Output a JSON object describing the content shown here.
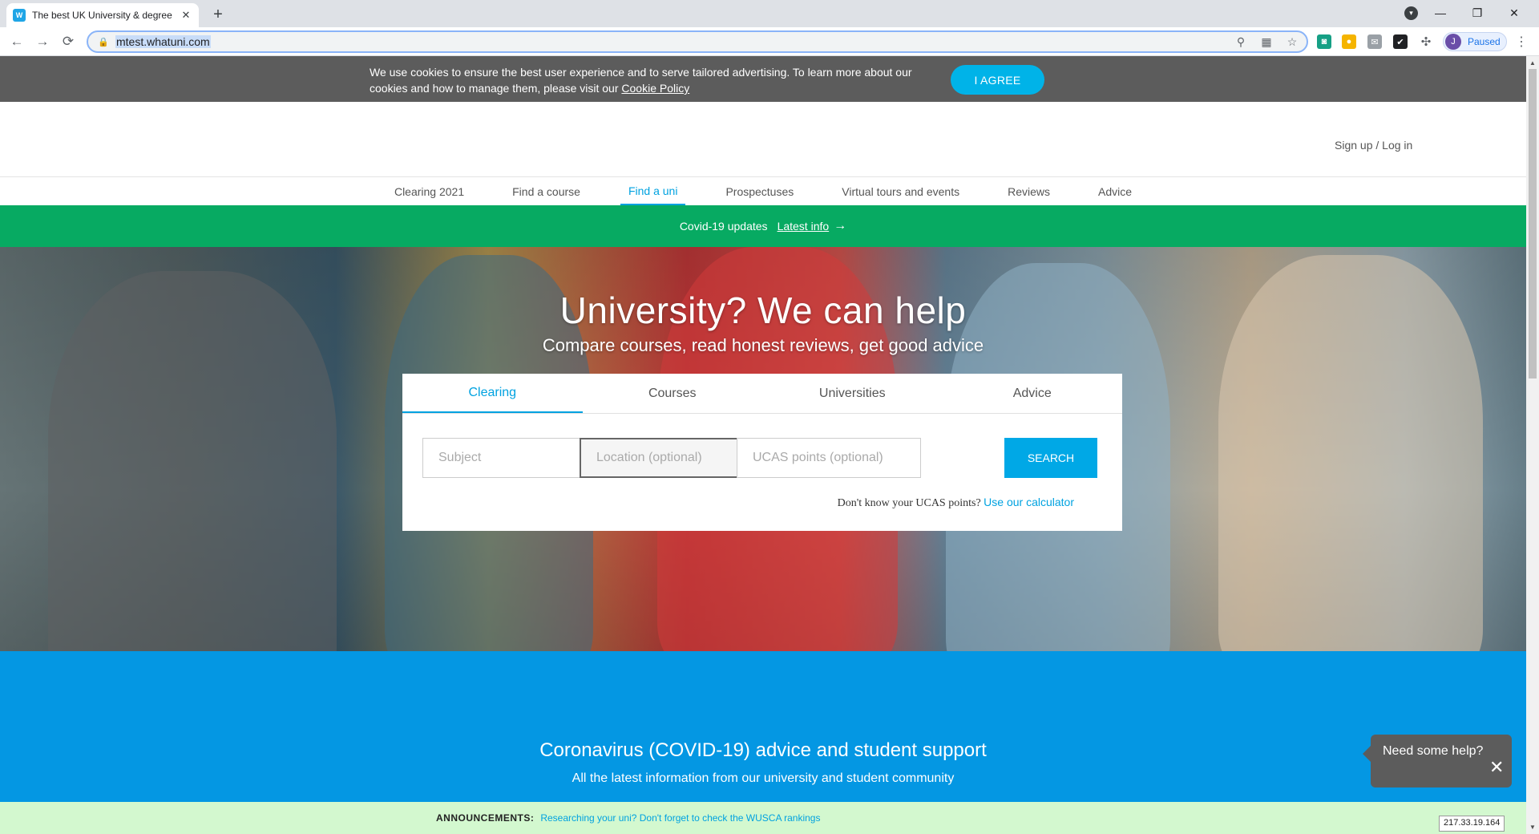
{
  "browser": {
    "tab_title": "The best UK University & degree",
    "favicon_text": "W",
    "url": "mtest.whatuni.com",
    "profile_initial": "J",
    "profile_status": "Paused"
  },
  "cookie": {
    "text": "We use cookies to ensure the best user experience and to serve tailored advertising. To learn more about our cookies and how to manage them, please visit our",
    "policy_link": "Cookie Policy",
    "agree_button": "I AGREE"
  },
  "header": {
    "signup_login": "Sign up / Log in"
  },
  "nav": {
    "items": [
      {
        "label": "Clearing 2021"
      },
      {
        "label": "Find a course"
      },
      {
        "label": "Find a uni"
      },
      {
        "label": "Prospectuses"
      },
      {
        "label": "Virtual tours and events"
      },
      {
        "label": "Reviews"
      },
      {
        "label": "Advice"
      }
    ],
    "active": "Find a uni"
  },
  "covid_bar": {
    "text": "Covid-19 updates",
    "link": "Latest info",
    "arrow": "→"
  },
  "hero": {
    "title": "University? We can help",
    "subtitle": "Compare courses, read honest reviews, get good advice"
  },
  "search": {
    "tabs": [
      {
        "label": "Clearing"
      },
      {
        "label": "Courses"
      },
      {
        "label": "Universities"
      },
      {
        "label": "Advice"
      }
    ],
    "active_tab": "Clearing",
    "subject_placeholder": "Subject",
    "location_placeholder": "Location (optional)",
    "ucas_placeholder": "UCAS points (optional)",
    "button": "SEARCH",
    "help_text": "Don't know your UCAS points?",
    "help_link": "Use our calculator"
  },
  "advice": {
    "title": "Coronavirus (COVID-19) advice and student support",
    "subtitle": "All the latest information from our university and student community"
  },
  "help_bubble": {
    "text": "Need some help?",
    "close": "✕"
  },
  "announcements": {
    "label": "ANNOUNCEMENTS:",
    "text": "Researching your uni? Don't forget to check the WUSCA rankings"
  },
  "ip_address": "217.33.19.164",
  "colors": {
    "brand_blue": "#00a2e0",
    "covid_green": "#07aa62",
    "advice_blue": "#0497e3",
    "cookie_gray": "#5c5c5c",
    "announce_green": "#d3f8cf"
  }
}
